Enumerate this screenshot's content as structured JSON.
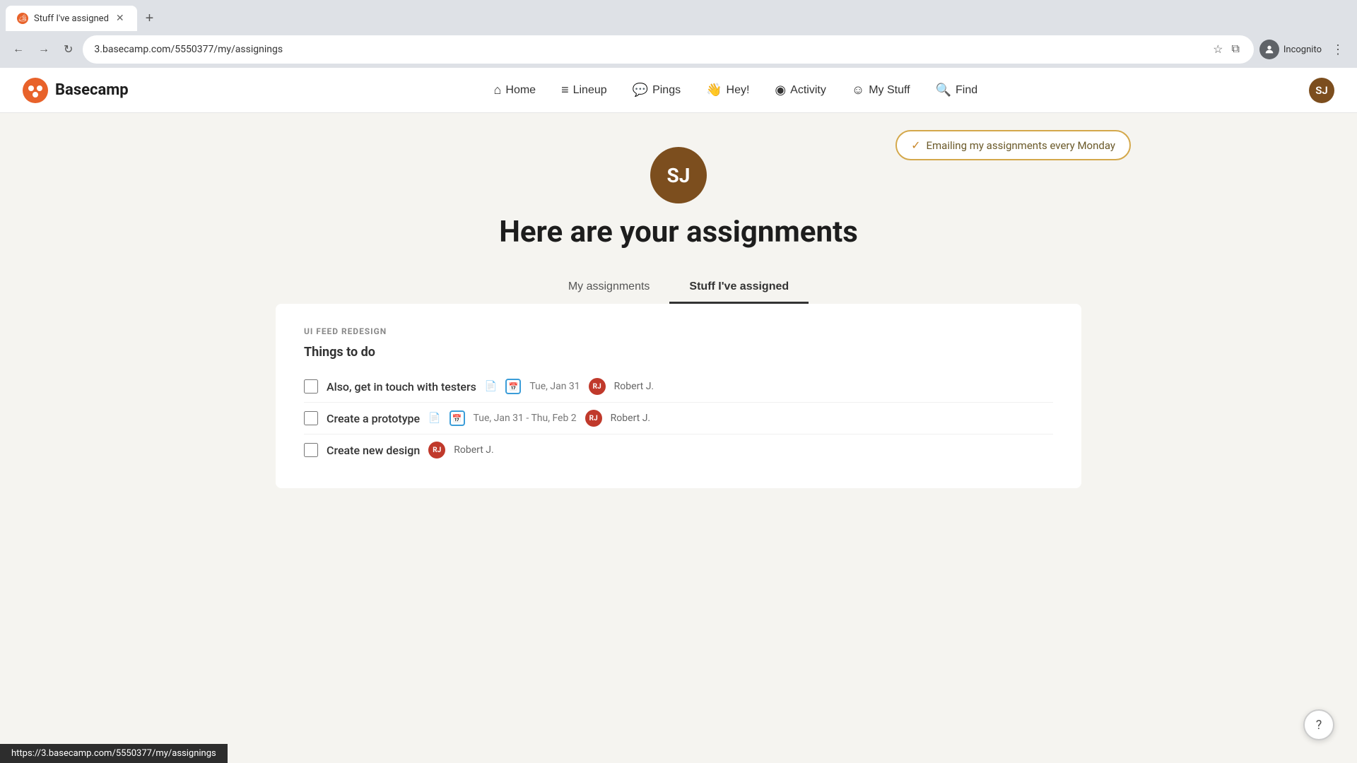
{
  "browser": {
    "tab_title": "Stuff I've assigned",
    "tab_favicon": "🏕",
    "url": "3.basecamp.com/5550377/my/assignings",
    "new_tab_label": "+",
    "nav": {
      "back": "←",
      "forward": "→",
      "refresh": "↻",
      "star": "☆",
      "sidebar": "⧉",
      "more": "⋮"
    },
    "incognito_label": "Incognito",
    "status_url": "https://3.basecamp.com/5550377/my/assignings"
  },
  "appnav": {
    "brand_name": "Basecamp",
    "user_initials": "SJ",
    "nav_items": [
      {
        "id": "home",
        "label": "Home",
        "icon": "⌂"
      },
      {
        "id": "lineup",
        "label": "Lineup",
        "icon": "≡"
      },
      {
        "id": "pings",
        "label": "Pings",
        "icon": "💬"
      },
      {
        "id": "hey",
        "label": "Hey!",
        "icon": "👋"
      },
      {
        "id": "activity",
        "label": "Activity",
        "icon": "◉"
      },
      {
        "id": "mystuff",
        "label": "My Stuff",
        "icon": "☺"
      },
      {
        "id": "find",
        "label": "Find",
        "icon": "🔍"
      }
    ]
  },
  "page": {
    "email_badge": "Emailing my assignments every Monday",
    "email_check": "✓",
    "user_initials": "SJ",
    "title": "Here are your assignments",
    "tabs": [
      {
        "id": "my-assignments",
        "label": "My assignments",
        "active": false
      },
      {
        "id": "stuff-ive-assigned",
        "label": "Stuff I've assigned",
        "active": true
      }
    ],
    "section_label": "UI FEED REDESIGN",
    "section_subtitle": "Things to do",
    "tasks": [
      {
        "id": 1,
        "title": "Also, get in touch with testers",
        "has_notes": true,
        "has_calendar": true,
        "date": "Tue, Jan 31",
        "assignee_initials": "RJ",
        "assignee_name": "Robert J."
      },
      {
        "id": 2,
        "title": "Create a prototype",
        "has_notes": true,
        "has_calendar": true,
        "date": "Tue, Jan 31 - Thu, Feb 2",
        "assignee_initials": "RJ",
        "assignee_name": "Robert J."
      },
      {
        "id": 3,
        "title": "Create new design",
        "has_notes": false,
        "has_calendar": false,
        "date": null,
        "assignee_initials": "RJ",
        "assignee_name": "Robert J."
      }
    ]
  },
  "help": {
    "icon": "?"
  }
}
